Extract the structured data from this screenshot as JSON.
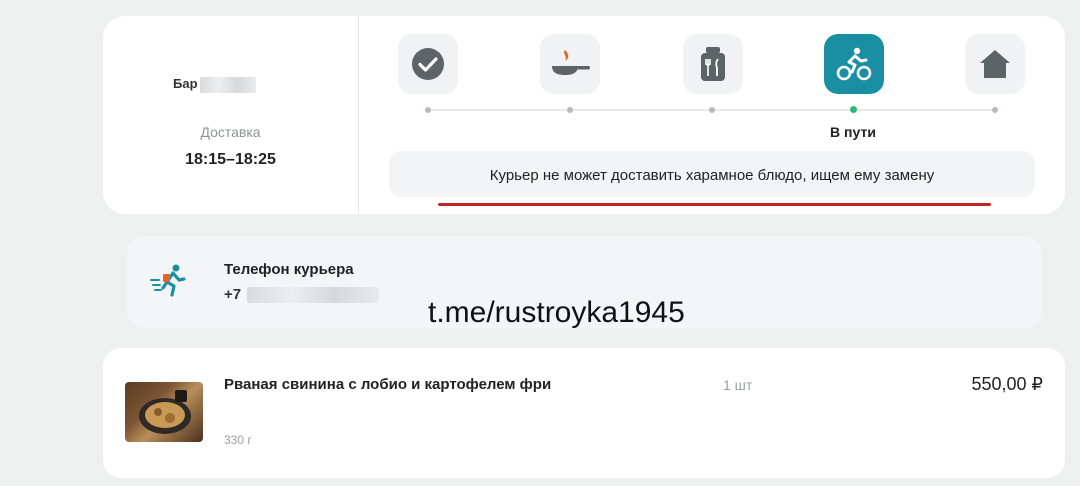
{
  "order": {
    "store_name": "Бар",
    "delivery_label": "Доставка",
    "delivery_time": "18:15–18:25",
    "steps": [
      {
        "icon": "check-icon",
        "active": false
      },
      {
        "icon": "frying-pan-icon",
        "active": false
      },
      {
        "icon": "food-package-icon",
        "active": false
      },
      {
        "icon": "courier-bike-icon",
        "active": true
      },
      {
        "icon": "home-icon",
        "active": false
      }
    ],
    "current_step_label": "В пути",
    "notice": "Курьер не может доставить харамное блюдо, ищем ему замену"
  },
  "courier": {
    "title": "Телефон курьера",
    "phone_prefix": "+7"
  },
  "watermark": "t.me/rustroyka1945",
  "item": {
    "name": "Рваная свинина с лобио и картофелем фри",
    "weight": "330 г",
    "quantity": "1 шт",
    "price": "550,00 ₽"
  },
  "colors": {
    "accent": "#1a8fa4",
    "progress_dot_active": "#2fb67a",
    "underline": "#c2262b"
  }
}
